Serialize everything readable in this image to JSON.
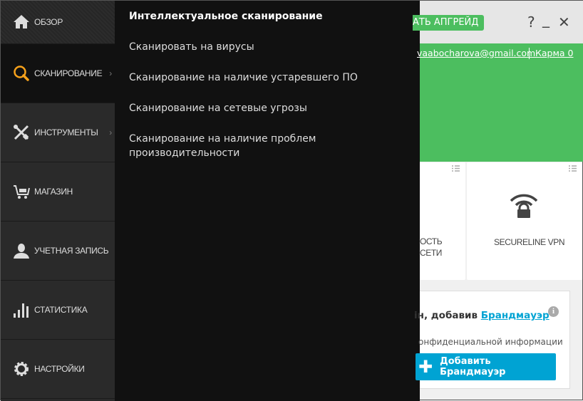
{
  "sidebar": {
    "items": [
      {
        "label": "ОБЗОР",
        "icon": "home-icon"
      },
      {
        "label": "СКАНИРОВАНИЕ",
        "icon": "search-icon",
        "active": true,
        "has_submenu": true
      },
      {
        "label": "ИНСТРУМЕНТЫ",
        "icon": "tools-icon",
        "has_submenu": true
      },
      {
        "label": "МАГАЗИН",
        "icon": "cart-icon"
      },
      {
        "label": "УЧЕТНАЯ ЗАПИСЬ",
        "icon": "user-icon"
      },
      {
        "label": "СТАТИСТИКА",
        "icon": "stats-icon"
      },
      {
        "label": "НАСТРОЙКИ",
        "icon": "gear-icon"
      }
    ],
    "chevron": "›"
  },
  "submenu": {
    "title": "Интеллектуальное сканирование",
    "items": [
      "Сканировать на вирусы",
      "Сканирование на наличие устаревшего ПО",
      "Сканирование на сетевые угрозы",
      "Сканирование на наличие проблем производительности"
    ]
  },
  "topbar": {
    "upgrade_label": "АТЬ АПГРЕЙД",
    "help": "?",
    "minimize": "_",
    "close": "✕"
  },
  "account": {
    "email": "vaabocharova@gmail.com",
    "karma": "Карма 0"
  },
  "tiles": [
    {
      "label_line1": "ОСТЬ",
      "label_line2": "СЕТИ"
    },
    {
      "label": "SECURELINE VPN"
    }
  ],
  "promo": {
    "text": "ін, добавив ",
    "link": "Брандмауэр",
    "description": "онфиденциальной информации",
    "button": "Добавить Брандмауэр",
    "info": "i"
  },
  "colors": {
    "accent_green": "#4cbe5f",
    "accent_blue": "#00a3d3",
    "scan_orange": "#f7a21b"
  }
}
